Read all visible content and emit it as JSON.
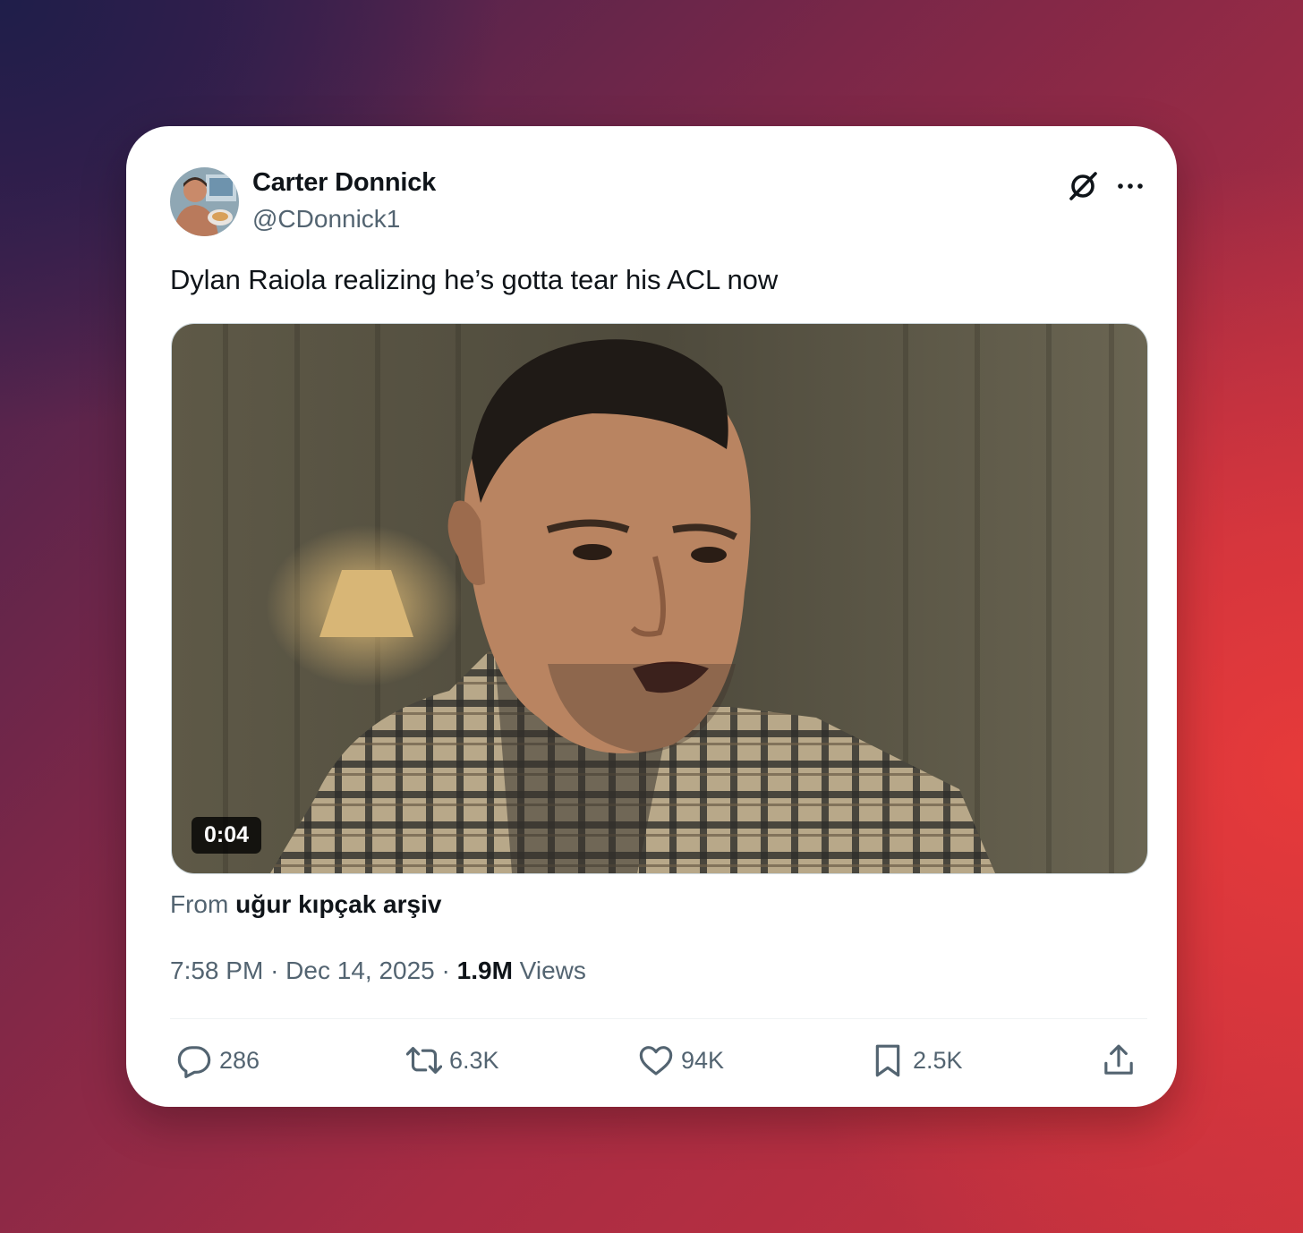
{
  "author": {
    "display_name": "Carter Donnick",
    "handle": "@CDonnick1",
    "avatar_icon": "profile-photo"
  },
  "header_icons": {
    "grok": "grok-icon",
    "more": "more-icon"
  },
  "tweet": {
    "text": "Dylan Raiola realizing he’s gotta tear his ACL now"
  },
  "media": {
    "type": "video",
    "duration": "0:04"
  },
  "source": {
    "prefix": "From",
    "name": "uğur kıpçak arşiv"
  },
  "meta": {
    "time": "7:58 PM",
    "date": "Dec 14, 2025",
    "views_count": "1.9M",
    "views_label": "Views"
  },
  "actions": {
    "replies": "286",
    "reposts": "6.3K",
    "likes": "94K",
    "bookmarks": "2.5K"
  },
  "colors": {
    "text_primary": "#0f1419",
    "text_secondary": "#536471",
    "card_bg": "#ffffff"
  }
}
